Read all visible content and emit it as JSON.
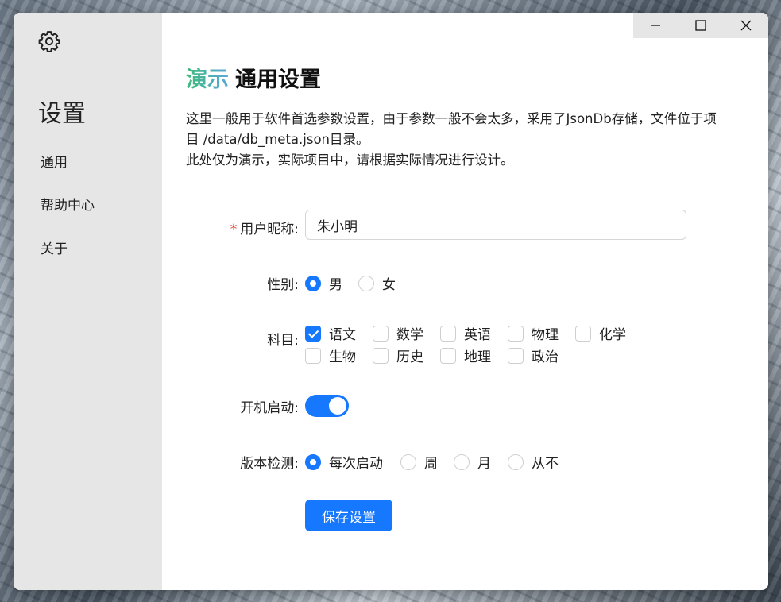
{
  "window": {
    "controls": {
      "minimize": "—",
      "maximize": "☐",
      "close": "✕"
    }
  },
  "sidebar": {
    "icon": "gear-icon",
    "title": "设置",
    "items": [
      {
        "label": "通用"
      },
      {
        "label": "帮助中心"
      },
      {
        "label": "关于"
      }
    ]
  },
  "page": {
    "heading_accent": "演示",
    "heading_main": "通用设置",
    "description_lines": [
      "这里一般用于软件首选参数设置，由于参数一般不会太多，采用了JsonDb存储，文件位于项",
      "目 /data/db_meta.json目录。",
      "此处仅为演示，实际项目中，请根据实际情况进行设计。"
    ]
  },
  "form": {
    "required_mark": "*",
    "nickname": {
      "label": "用户昵称:",
      "value": "朱小明"
    },
    "gender": {
      "label": "性别:",
      "options": [
        {
          "label": "男",
          "checked": true
        },
        {
          "label": "女",
          "checked": false
        }
      ]
    },
    "subjects": {
      "label": "科目:",
      "options": [
        {
          "label": "语文",
          "checked": true
        },
        {
          "label": "数学",
          "checked": false
        },
        {
          "label": "英语",
          "checked": false
        },
        {
          "label": "物理",
          "checked": false
        },
        {
          "label": "化学",
          "checked": false
        },
        {
          "label": "生物",
          "checked": false
        },
        {
          "label": "历史",
          "checked": false
        },
        {
          "label": "地理",
          "checked": false
        },
        {
          "label": "政治",
          "checked": false
        }
      ]
    },
    "autostart": {
      "label": "开机启动:",
      "on": true
    },
    "update_check": {
      "label": "版本检测:",
      "options": [
        {
          "label": "每次启动",
          "checked": true
        },
        {
          "label": "周",
          "checked": false
        },
        {
          "label": "月",
          "checked": false
        },
        {
          "label": "从不",
          "checked": false
        }
      ]
    },
    "save_label": "保存设置"
  },
  "colors": {
    "accent": "#1677ff",
    "sidebar_bg": "#e6e6e6",
    "required": "#e0453a"
  }
}
